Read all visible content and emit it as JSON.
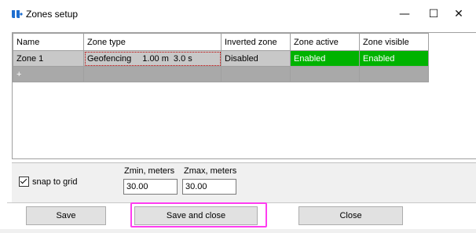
{
  "window": {
    "title": "Zones setup",
    "minimize_glyph": "—",
    "maximize_glyph": "☐",
    "close_glyph": "✕",
    "icon": "app-logo-icon",
    "icon_color": "#1f6fd0"
  },
  "grid": {
    "columns": [
      "Name",
      "Zone type",
      "Inverted zone",
      "Zone active",
      "Zone visible"
    ],
    "rows": [
      {
        "name": "Zone 1",
        "zone_type": "Geofencing",
        "zone_radius": "1.00 m",
        "zone_time": "3.0 s",
        "inverted": "Disabled",
        "active": "Enabled",
        "visible": "Enabled"
      }
    ],
    "add_row_label": "+",
    "colors": {
      "enabled_bg": "#00b300",
      "row_bg": "#c8c8c8",
      "add_row_bg": "#a9a9a9"
    }
  },
  "options": {
    "snap_label": "snap to grid",
    "snap_checked": true,
    "zmin_label": "Zmin, meters",
    "zmin_value": "30.00",
    "zmax_label": "Zmax, meters",
    "zmax_value": "30.00"
  },
  "buttons": {
    "save": "Save",
    "save_and_close": "Save and close",
    "close": "Close",
    "highlight_color": "#ff3df0"
  }
}
